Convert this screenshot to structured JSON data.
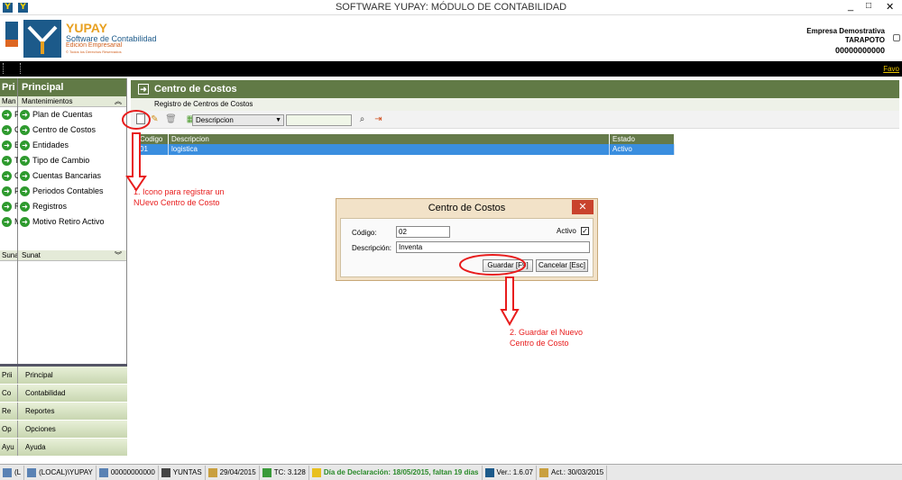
{
  "window": {
    "title": "SOFTWARE YUPAY: MÓDULO DE CONTABILIDAD",
    "controls": [
      "_",
      "□",
      "✕"
    ]
  },
  "header": {
    "brand_name": "YUPAY",
    "brand_line1": "Software de Contabilidad",
    "brand_line2": "Edición Empresarial",
    "brand_line3": "© Todos los Derechos Reservados",
    "company_name": "Empresa Demostrativa",
    "company_city": "TARAPOTO",
    "company_ruc": "00000000000",
    "favorites": "Favo"
  },
  "sidebar": {
    "narrow_head": "Pri",
    "head": "Principal",
    "section_mant_short": "Man",
    "section_mant": "Mantenimientos",
    "items": [
      {
        "short": "P",
        "label": "Plan de Cuentas"
      },
      {
        "short": "C",
        "label": "Centro de Costos"
      },
      {
        "short": "E",
        "label": "Entidades"
      },
      {
        "short": "T",
        "label": "Tipo de Cambio"
      },
      {
        "short": "C",
        "label": "Cuentas Bancarias"
      },
      {
        "short": "P",
        "label": "Periodos Contables"
      },
      {
        "short": "R",
        "label": "Registros"
      },
      {
        "short": "M",
        "label": "Motivo Retiro Activo"
      }
    ],
    "section_sunat_short": "Suna",
    "section_sunat": "Sunat"
  },
  "bottom_nav": [
    {
      "short": "Prii",
      "label": "Principal"
    },
    {
      "short": "Co",
      "label": "Contabilidad"
    },
    {
      "short": "Re",
      "label": "Reportes"
    },
    {
      "short": "Op",
      "label": "Opciones"
    },
    {
      "short": "Ayu",
      "label": "Ayuda"
    }
  ],
  "main": {
    "title": "Centro de Costos",
    "subtitle": "Registro de Centros de Costos",
    "search_field": "Descripcion",
    "grid": {
      "columns": [
        "Codigo",
        "Descripcion",
        "Estado"
      ],
      "rows": [
        [
          "01",
          "logistica",
          "Activo"
        ]
      ]
    }
  },
  "dialog": {
    "title": "Centro de Costos",
    "codigo_label": "Código:",
    "codigo_value": "02",
    "activo_label": "Activo",
    "activo_checked": true,
    "descripcion_label": "Descripción:",
    "descripcion_value": "Inventa",
    "save_label": "Guardar [F9]",
    "cancel_label": "Cancelar [Esc]"
  },
  "annotations": {
    "note1": "1. Icono para registrar un NUevo Centro de Costo",
    "note2": "2. Guardar el Nuevo Centro de Costo",
    "color": "#e81c1c"
  },
  "status": {
    "db": "(LOCAL)\\YUPAY",
    "ruc": "00000000000",
    "user": "YUNTAS",
    "date": "29/04/2015",
    "tc": "TC: 3.128",
    "declaracion": "Día de Declaración: 18/05/2015, faltan 19 días",
    "version": "Ver.: 1.6.07",
    "updated": "Act.: 30/03/2015",
    "first": "(L"
  }
}
